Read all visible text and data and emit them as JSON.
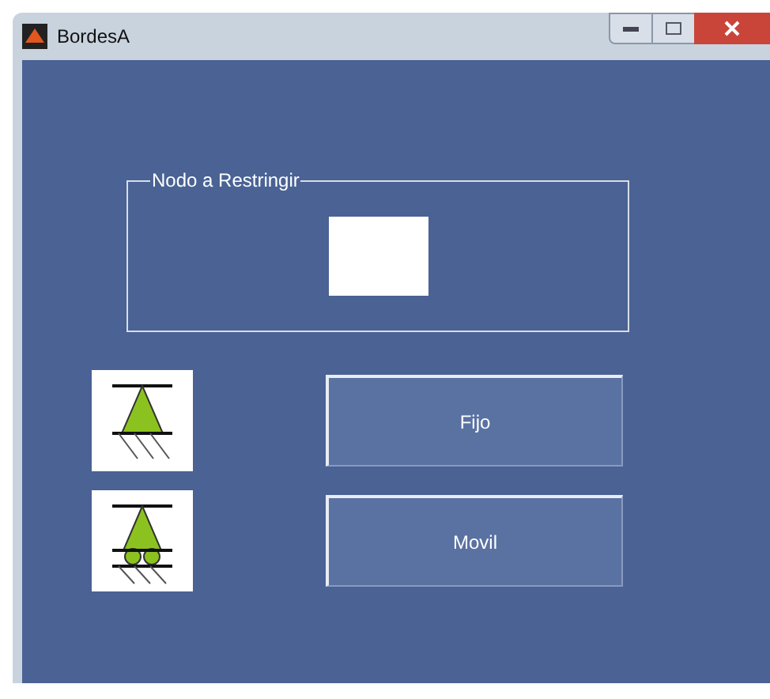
{
  "window": {
    "title": "BordesA"
  },
  "panel": {
    "title": "Nodo a Restringir"
  },
  "supports": [
    {
      "kind": "fixed",
      "button": "Fijo"
    },
    {
      "kind": "roller",
      "button": "Movil"
    }
  ]
}
